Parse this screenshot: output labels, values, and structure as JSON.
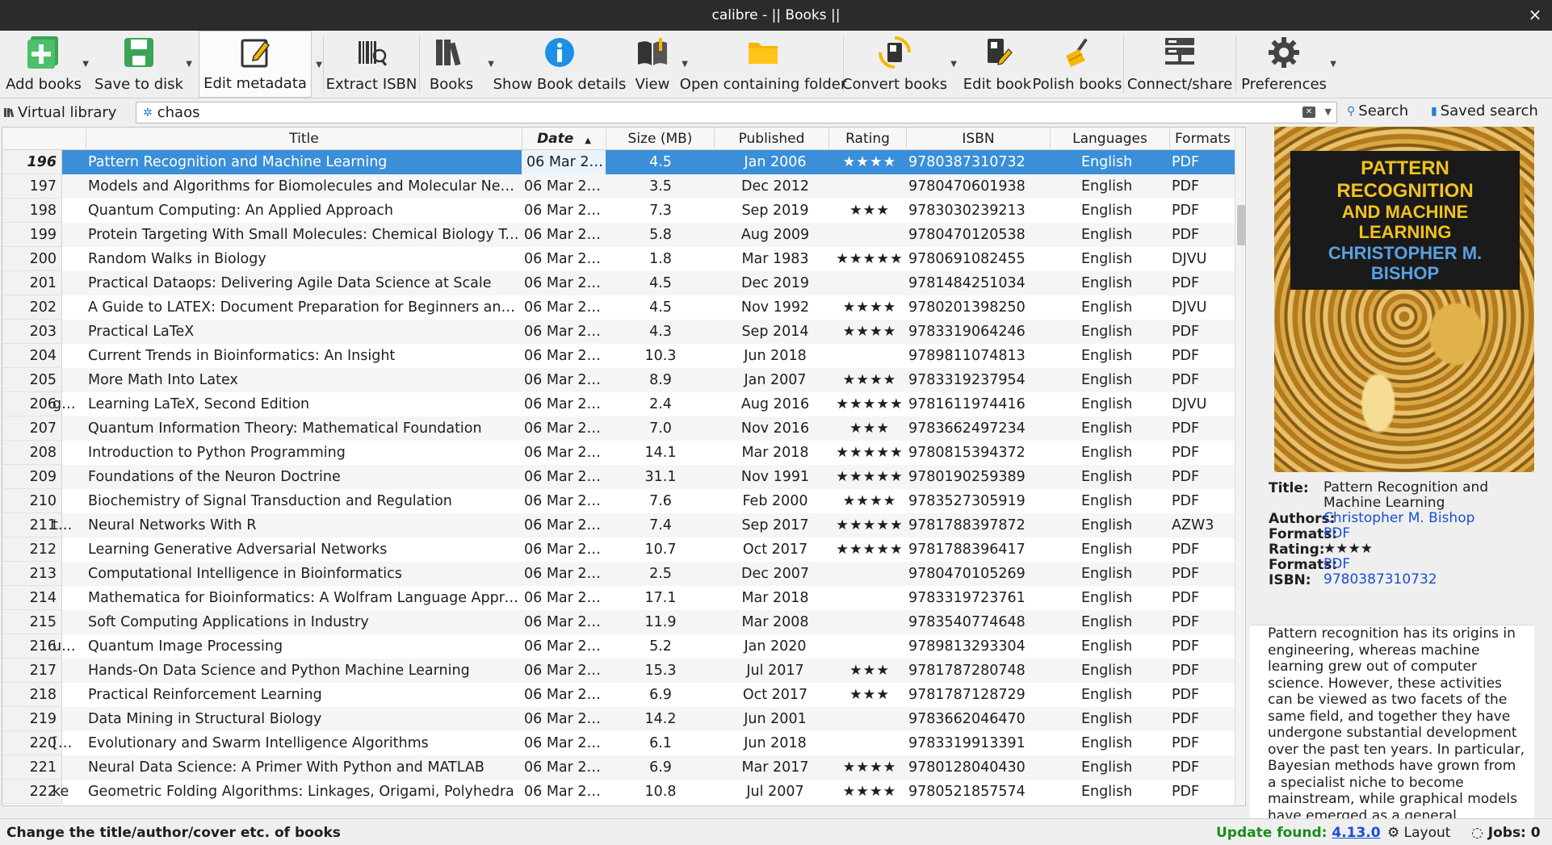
{
  "window": {
    "title": "calibre - || Books ||",
    "close_glyph": "×"
  },
  "toolbar": {
    "buttons": [
      {
        "label": "Add books",
        "icon": "add-books-icon"
      },
      {
        "label": "Save to disk",
        "icon": "save-icon"
      },
      {
        "label": "Edit metadata",
        "icon": "edit-metadata-icon"
      },
      {
        "label": "Extract ISBN",
        "icon": "barcode-icon"
      },
      {
        "label": "Books",
        "icon": "library-icon"
      },
      {
        "label": "Show Book details",
        "icon": "info-icon"
      },
      {
        "label": "View",
        "icon": "book-view-icon"
      },
      {
        "label": "Open containing folder",
        "icon": "folder-icon"
      },
      {
        "label": "Convert books",
        "icon": "convert-icon"
      },
      {
        "label": "Edit book",
        "icon": "edit-book-icon"
      },
      {
        "label": "Polish books",
        "icon": "polish-icon"
      },
      {
        "label": "Connect/share",
        "icon": "server-icon"
      },
      {
        "label": "Preferences",
        "icon": "gear-icon"
      }
    ]
  },
  "search": {
    "virtual_library": "Virtual library",
    "query": "chaos",
    "search_label": "Search",
    "saved_search_label": "Saved search"
  },
  "table": {
    "columns": [
      "Title",
      "Date",
      "Size (MB)",
      "Published",
      "Rating",
      "ISBN",
      "Languages",
      "Formats"
    ],
    "sorted_column": "Date",
    "rows": [
      {
        "num": "196",
        "title": "Pattern Recognition and Machine Learning",
        "date": "06 Mar 2…",
        "size": "4.5",
        "published": "Jan 2006",
        "rating": "★★★★",
        "isbn": "9780387310732",
        "lang": "English",
        "fmt": "PDF",
        "selected": true
      },
      {
        "num": "197",
        "title": "Models and Algorithms for Biomolecules and Molecular Net…",
        "date": "06 Mar 2…",
        "size": "3.5",
        "published": "Dec 2012",
        "rating": "",
        "isbn": "9780470601938",
        "lang": "English",
        "fmt": "PDF"
      },
      {
        "num": "198",
        "title": "Quantum Computing: An Applied Approach",
        "date": "06 Mar 2…",
        "size": "7.3",
        "published": "Sep 2019",
        "rating": "★★★",
        "isbn": "9783030239213",
        "lang": "English",
        "fmt": "PDF"
      },
      {
        "num": "199",
        "title": "Protein Targeting With Small Molecules: Chemical Biology Te…",
        "date": "06 Mar 2…",
        "size": "5.8",
        "published": "Aug 2009",
        "rating": "",
        "isbn": "9780470120538",
        "lang": "English",
        "fmt": "PDF"
      },
      {
        "num": "200",
        "title": "Random Walks in Biology",
        "date": "06 Mar 2…",
        "size": "1.8",
        "published": "Mar 1983",
        "rating": "★★★★★",
        "isbn": "9780691082455",
        "lang": "English",
        "fmt": "DJVU"
      },
      {
        "num": "201",
        "title": "Practical Dataops: Delivering Agile Data Science at Scale",
        "date": "06 Mar 2…",
        "size": "4.5",
        "published": "Dec 2019",
        "rating": "",
        "isbn": "9781484251034",
        "lang": "English",
        "fmt": "PDF"
      },
      {
        "num": "202",
        "title": "A Guide to LATEX: Document Preparation for Beginners and …",
        "date": "06 Mar 2…",
        "size": "4.5",
        "published": "Nov 1992",
        "rating": "★★★★",
        "isbn": "9780201398250",
        "lang": "English",
        "fmt": "DJVU"
      },
      {
        "num": "203",
        "title": "Practical LaTeX",
        "date": "06 Mar 2…",
        "size": "4.3",
        "published": "Sep 2014",
        "rating": "★★★★",
        "isbn": "9783319064246",
        "lang": "English",
        "fmt": "PDF"
      },
      {
        "num": "204",
        "title": "Current Trends in Bioinformatics: An Insight",
        "date": "06 Mar 2…",
        "size": "10.3",
        "published": "Jun 2018",
        "rating": "",
        "isbn": "9789811074813",
        "lang": "English",
        "fmt": "PDF"
      },
      {
        "num": "205",
        "title": "More Math Into Latex",
        "date": "06 Mar 2…",
        "size": "8.9",
        "published": "Jan 2007",
        "rating": "★★★★",
        "isbn": "9783319237954",
        "lang": "English",
        "fmt": "PDF"
      },
      {
        "num": "206",
        "title": "Learning LaTeX, Second Edition",
        "date": "06 Mar 2…",
        "size": "2.4",
        "published": "Aug 2016",
        "rating": "★★★★★",
        "isbn": "9781611974416",
        "lang": "English",
        "fmt": "DJVU",
        "ghost": "g…"
      },
      {
        "num": "207",
        "title": "Quantum Information Theory: Mathematical Foundation",
        "date": "06 Mar 2…",
        "size": "7.0",
        "published": "Nov 2016",
        "rating": "★★★",
        "isbn": "9783662497234",
        "lang": "English",
        "fmt": "PDF"
      },
      {
        "num": "208",
        "title": "Introduction to Python Programming",
        "date": "06 Mar 2…",
        "size": "14.1",
        "published": "Mar 2018",
        "rating": "★★★★★",
        "isbn": "9780815394372",
        "lang": "English",
        "fmt": "PDF"
      },
      {
        "num": "209",
        "title": "Foundations of the Neuron Doctrine",
        "date": "06 Mar 2…",
        "size": "31.1",
        "published": "Nov 1991",
        "rating": "★★★★★",
        "isbn": "9780190259389",
        "lang": "English",
        "fmt": "PDF"
      },
      {
        "num": "210",
        "title": "Biochemistry of Signal Transduction and Regulation",
        "date": "06 Mar 2…",
        "size": "7.6",
        "published": "Feb 2000",
        "rating": "★★★★",
        "isbn": "9783527305919",
        "lang": "English",
        "fmt": "PDF"
      },
      {
        "num": "211",
        "title": "Neural Networks With R",
        "date": "06 Mar 2…",
        "size": "7.4",
        "published": "Sep 2017",
        "rating": "★★★★★",
        "isbn": "9781788397872",
        "lang": "English",
        "fmt": "AZW3",
        "ghost": "t…"
      },
      {
        "num": "212",
        "title": "Learning Generative Adversarial Networks",
        "date": "06 Mar 2…",
        "size": "10.7",
        "published": "Oct 2017",
        "rating": "★★★★★",
        "isbn": "9781788396417",
        "lang": "English",
        "fmt": "PDF"
      },
      {
        "num": "213",
        "title": "Computational Intelligence in Bioinformatics",
        "date": "06 Mar 2…",
        "size": "2.5",
        "published": "Dec 2007",
        "rating": "",
        "isbn": "9780470105269",
        "lang": "English",
        "fmt": "PDF"
      },
      {
        "num": "214",
        "title": "Mathematica for Bioinformatics: A Wolfram Language Appro…",
        "date": "06 Mar 2…",
        "size": "17.1",
        "published": "Mar 2018",
        "rating": "",
        "isbn": "9783319723761",
        "lang": "English",
        "fmt": "PDF"
      },
      {
        "num": "215",
        "title": "Soft Computing Applications in Industry",
        "date": "06 Mar 2…",
        "size": "11.9",
        "published": "Mar 2008",
        "rating": "",
        "isbn": "9783540774648",
        "lang": "English",
        "fmt": "PDF"
      },
      {
        "num": "216",
        "title": "Quantum Image Processing",
        "date": "06 Mar 2…",
        "size": "5.2",
        "published": "Jan 2020",
        "rating": "",
        "isbn": "9789813293304",
        "lang": "English",
        "fmt": "PDF",
        "ghost": "u…"
      },
      {
        "num": "217",
        "title": "Hands-On Data Science and Python Machine Learning",
        "date": "06 Mar 2…",
        "size": "15.3",
        "published": "Jul 2017",
        "rating": "★★★",
        "isbn": "9781787280748",
        "lang": "English",
        "fmt": "PDF"
      },
      {
        "num": "218",
        "title": "Practical Reinforcement Learning",
        "date": "06 Mar 2…",
        "size": "6.9",
        "published": "Oct 2017",
        "rating": "★★★",
        "isbn": "9781787128729",
        "lang": "English",
        "fmt": "PDF"
      },
      {
        "num": "219",
        "title": "Data Mining in Structural Biology",
        "date": "06 Mar 2…",
        "size": "14.2",
        "published": "Jun 2001",
        "rating": "",
        "isbn": "9783662046470",
        "lang": "English",
        "fmt": "PDF"
      },
      {
        "num": "220",
        "title": "Evolutionary and Swarm Intelligence Algorithms",
        "date": "06 Mar 2…",
        "size": "6.1",
        "published": "Jun 2018",
        "rating": "",
        "isbn": "9783319913391",
        "lang": "English",
        "fmt": "PDF",
        "ghost": "[…"
      },
      {
        "num": "221",
        "title": "Neural Data Science: A Primer With Python and MATLAB",
        "date": "06 Mar 2…",
        "size": "6.9",
        "published": "Mar 2017",
        "rating": "★★★★",
        "isbn": "9780128040430",
        "lang": "English",
        "fmt": "PDF"
      },
      {
        "num": "222",
        "title": "Geometric Folding Algorithms: Linkages, Origami, Polyhedra",
        "date": "06 Mar 2…",
        "size": "10.8",
        "published": "Jul 2007",
        "rating": "★★★★",
        "isbn": "9780521857574",
        "lang": "English",
        "fmt": "PDF",
        "ghost": "ke"
      }
    ]
  },
  "cover": {
    "line1": "PATTERN RECOGNITION",
    "line2": "AND MACHINE LEARNING",
    "line3": "CHRISTOPHER M. BISHOP"
  },
  "details": {
    "title_label": "Title:",
    "title": "Pattern Recognition and Machine Learning",
    "authors_label": "Authors:",
    "authors": "Christopher M. Bishop",
    "formats_label": "Formats:",
    "formats": "PDF",
    "rating_label": "Rating:",
    "rating": "★★★★",
    "formats2_label": "Formats:",
    "formats2": "PDF",
    "isbn_label": "ISBN:",
    "isbn": "9780387310732",
    "comments": "Pattern recognition has its origins in engineering, whereas machine learning grew out of computer science. However, these activities can be viewed as two facets of the same field, and together they have undergone substantial development over the past ten years. In particular, Bayesian methods have grown from a specialist niche to become mainstream, while graphical models have emerged as a general"
  },
  "status": {
    "message": "Change the title/author/cover etc. of books",
    "update_label": "Update found:",
    "update_version": "4.13.0",
    "layout_label": "Layout",
    "jobs_label": "Jobs: 0"
  },
  "colors": {
    "selection": "#3a8fd8",
    "link": "#1a4ed6",
    "update": "#1a8d1a"
  }
}
